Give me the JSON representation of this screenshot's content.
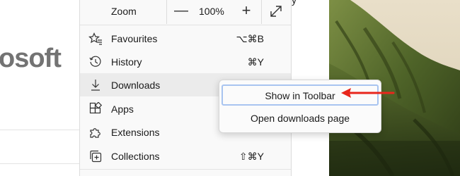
{
  "background": {
    "logo_fragment": "osoft",
    "page_fragment": "y"
  },
  "zoom": {
    "label": "Zoom",
    "minus": "—",
    "value": "100%",
    "plus": "+"
  },
  "menu": {
    "items": [
      {
        "label": "Favourites",
        "shortcut": "⌥⌘B"
      },
      {
        "label": "History",
        "shortcut": "⌘Y"
      },
      {
        "label": "Downloads",
        "shortcut": ""
      },
      {
        "label": "Apps",
        "shortcut": ""
      },
      {
        "label": "Extensions",
        "shortcut": ""
      },
      {
        "label": "Collections",
        "shortcut": "⇧⌘Y"
      }
    ]
  },
  "submenu": {
    "items": [
      {
        "label": "Show in Toolbar"
      },
      {
        "label": "Open downloads page"
      }
    ]
  },
  "colors": {
    "menu_bg": "#f9f9f9",
    "hover_bg": "#ebebeb",
    "focus_ring": "#a8c4f0",
    "annotation_arrow": "#e8261c"
  }
}
